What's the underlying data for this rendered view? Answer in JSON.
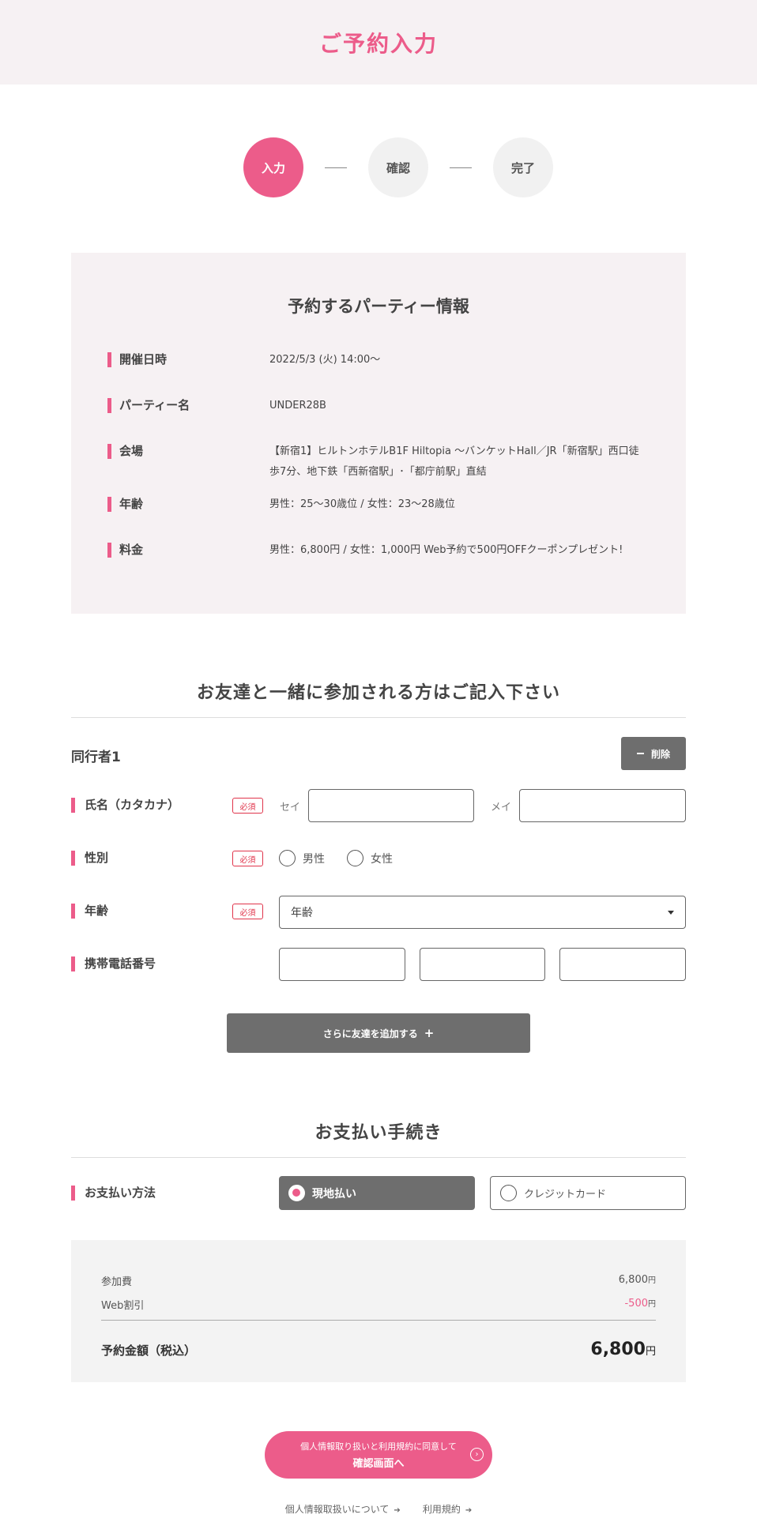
{
  "header": {
    "title": "ご予約入力"
  },
  "steps": [
    {
      "label": "入力",
      "active": true
    },
    {
      "label": "確認",
      "active": false
    },
    {
      "label": "完了",
      "active": false
    }
  ],
  "party": {
    "title": "予約するパーティー情報",
    "rows": [
      {
        "label": "開催日時",
        "value": "2022/5/3 (火) 14:00〜"
      },
      {
        "label": "パーティー名",
        "value": "UNDER28B"
      },
      {
        "label": "会場",
        "value_line1": "【新宿1】ヒルトンホテルB1F Hiltopia 〜バンケットHall／JR「新宿駅」西口徒",
        "value_line2": "歩7分、地下鉄「西新宿駅」･「都庁前駅」直結"
      },
      {
        "label": "年齢",
        "value": "男性：25〜30歳位 / 女性：23〜28歳位"
      },
      {
        "label": "料金",
        "value": "男性：6,800円 / 女性：1,000円 Web予約で500円OFFクーポンプレゼント!"
      }
    ]
  },
  "friends": {
    "section_title": "お友達と一緒に参加される方はご記入下さい",
    "companion_title": "同行者1",
    "delete_label": "削除",
    "required_label": "必須",
    "name_label": "氏名（カタカナ）",
    "sei_label": "セイ",
    "mei_label": "メイ",
    "sei_value": "",
    "mei_value": "",
    "gender_label": "性別",
    "gender_male": "男性",
    "gender_female": "女性",
    "age_label": "年齢",
    "age_select_value": "年齢",
    "phone_label": "携帯電話番号",
    "phone_values": [
      "",
      "",
      ""
    ],
    "add_button": "さらに友達を追加する"
  },
  "payment": {
    "section_title": "お支払い手続き",
    "method_label": "お支払い方法",
    "option_onsite": "現地払い",
    "option_card": "クレジットカード",
    "selected": "onsite"
  },
  "summary": {
    "fee_label": "参加費",
    "fee_value": "6,800",
    "discount_label": "Web割引",
    "discount_value": "-500",
    "yen": "円",
    "total_label": "予約金額（税込）",
    "total_value": "6,800"
  },
  "confirm": {
    "sub": "個人情報取り扱いと利用規約に同意して",
    "main": "確認画面へ"
  },
  "footer": {
    "privacy_link": "個人情報取扱いについて",
    "terms_link": "利用規約"
  },
  "colors": {
    "accent": "#ec5c8a",
    "required": "#e0344b",
    "button_gray": "#6e6e6e",
    "header_bg": "#f6f1f3"
  }
}
